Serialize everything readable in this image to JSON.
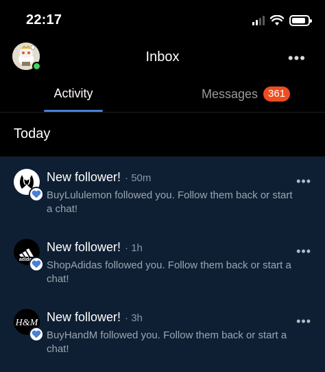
{
  "status_bar": {
    "time": "22:17",
    "signal_bars": 2,
    "battery_level": 0.85
  },
  "header": {
    "title": "Inbox",
    "more_icon": "more-horizontal-icon"
  },
  "tabs": [
    {
      "label": "Activity",
      "active": true
    },
    {
      "label": "Messages",
      "active": false,
      "badge": "361"
    }
  ],
  "section": {
    "title": "Today"
  },
  "notifications": [
    {
      "title": "New follower!",
      "time": "· 50m",
      "body": "BuyLululemon followed you. Follow them back or start a chat!",
      "avatar": "lululemon-logo-icon"
    },
    {
      "title": "New follower!",
      "time": "· 1h",
      "body": "ShopAdidas followed you. Follow them back or start a chat!",
      "avatar": "adidas-logo-icon",
      "avatar_text": "adidas"
    },
    {
      "title": "New follower!",
      "time": "· 3h",
      "body": "BuyHandM followed you. Follow them back or start a chat!",
      "avatar": "hm-logo-icon",
      "avatar_text": "H&M"
    }
  ],
  "colors": {
    "accent": "#4a7fd8",
    "badge": "#ef4d1f",
    "online": "#46d160",
    "list_background": "#0f1f33"
  }
}
